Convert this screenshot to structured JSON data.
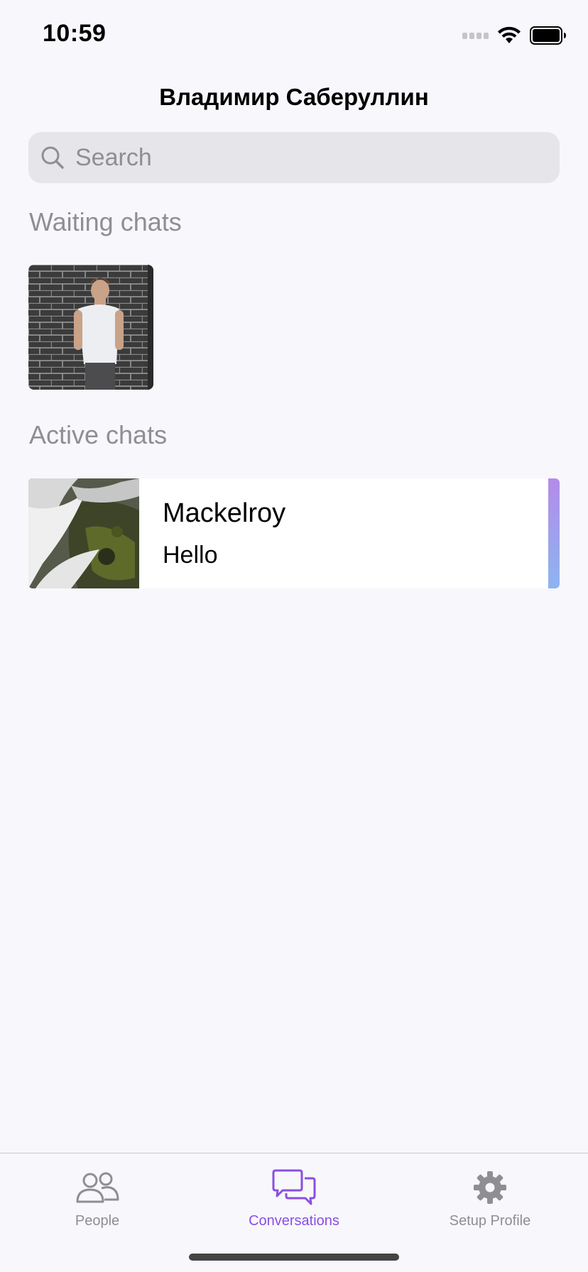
{
  "status_bar": {
    "time": "10:59"
  },
  "header": {
    "title": "Владимир Саберуллин"
  },
  "search": {
    "placeholder": "Search",
    "value": ""
  },
  "waiting_section": {
    "title": "Waiting chats"
  },
  "active_section": {
    "title": "Active chats",
    "chats": [
      {
        "name": "Mackelroy",
        "last_message": "Hello"
      }
    ]
  },
  "tab_bar": {
    "tabs": [
      {
        "label": "People",
        "icon": "people-icon",
        "selected": false
      },
      {
        "label": "Conversations",
        "icon": "conversations-icon",
        "selected": true
      },
      {
        "label": "Setup Profile",
        "icon": "gear-icon",
        "selected": false
      }
    ]
  },
  "colors": {
    "accent": "#8a4fe0",
    "inactive": "#8e8e93",
    "background": "#f7f7fc",
    "search_bg": "#e6e6ea"
  }
}
